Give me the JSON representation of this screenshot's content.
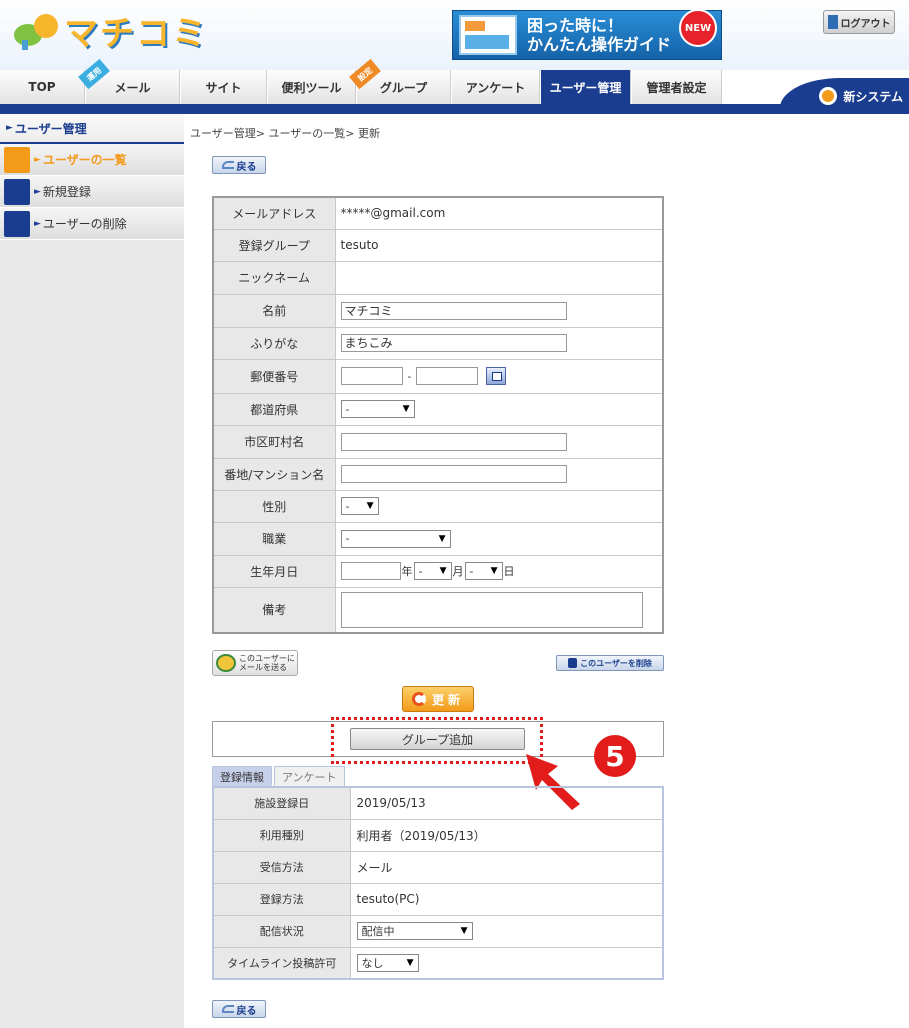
{
  "header": {
    "logo_text": "マチコミ",
    "banner_line1": "困った時に！",
    "banner_line2": "かんたん操作ガイド",
    "banner_badge": "NEW",
    "logout_label": "ログアウト"
  },
  "nav": {
    "tabs": [
      {
        "label": "TOP"
      },
      {
        "label": "メール",
        "tag": "運用"
      },
      {
        "label": "サイト"
      },
      {
        "label": "便利ツール"
      },
      {
        "label": "グループ",
        "tag": "設定"
      },
      {
        "label": "アンケート"
      },
      {
        "label": "ユーザー管理"
      },
      {
        "label": "管理者設定"
      }
    ],
    "new_system": "新システム"
  },
  "sidebar": {
    "title": "ユーザー管理",
    "items": [
      {
        "label": "ユーザーの一覧"
      },
      {
        "label": "新規登録"
      },
      {
        "label": "ユーザーの削除"
      }
    ]
  },
  "breadcrumb": "ユーザー管理> ユーザーの一覧> 更新",
  "buttons": {
    "back": "戻る",
    "send_mail_line1": "このユーザーに",
    "send_mail_line2": "メールを送る",
    "delete_user": "このユーザーを削除",
    "update": "更新",
    "add_group": "グループ追加"
  },
  "form": {
    "email_label": "メールアドレス",
    "email_value": "*****@gmail.com",
    "group_label": "登録グループ",
    "group_value": "tesuto",
    "nickname_label": "ニックネーム",
    "name_label": "名前",
    "name_value": "マチコミ",
    "kana_label": "ふりがな",
    "kana_value": "まちこみ",
    "zip_label": "郵便番号",
    "zip_sep": "-",
    "pref_label": "都道府県",
    "pref_value": "-",
    "city_label": "市区町村名",
    "address_label": "番地/マンション名",
    "gender_label": "性別",
    "gender_value": "-",
    "job_label": "職業",
    "job_value": "-",
    "birth_label": "生年月日",
    "birth_year_unit": "年",
    "birth_month_value": "-",
    "birth_month_unit": "月",
    "birth_day_value": "-",
    "birth_day_unit": "日",
    "note_label": "備考"
  },
  "annotation": {
    "step": "5"
  },
  "subtabs": {
    "info": "登録情報",
    "survey": "アンケート"
  },
  "info": {
    "reg_date_label": "施設登録日",
    "reg_date_value": "2019/05/13",
    "usage_label": "利用種別",
    "usage_value": "利用者（2019/05/13）",
    "receive_label": "受信方法",
    "receive_value": "メール",
    "method_label": "登録方法",
    "method_value": "tesuto(PC)",
    "delivery_label": "配信状況",
    "delivery_value": "配信中",
    "timeline_label": "タイムライン投稿許可",
    "timeline_value": "なし"
  }
}
